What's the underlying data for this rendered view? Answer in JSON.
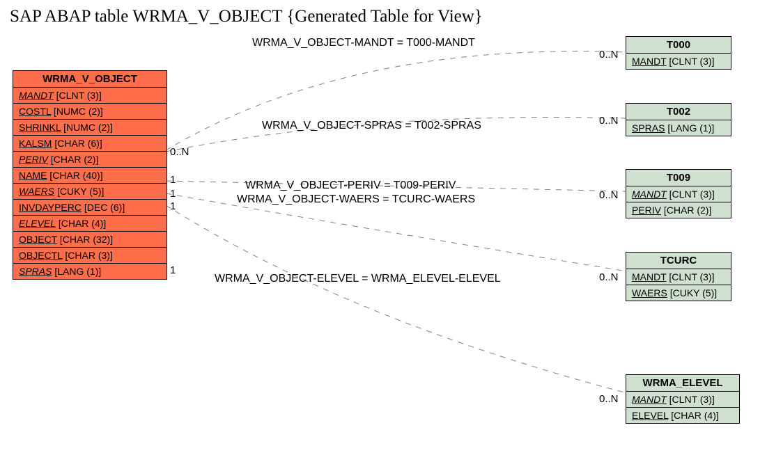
{
  "title": "SAP ABAP table WRMA_V_OBJECT {Generated Table for View}",
  "mainEntity": {
    "name": "WRMA_V_OBJECT",
    "fields": [
      {
        "name": "MANDT",
        "type": "[CLNT (3)]",
        "italic": true,
        "underline": true
      },
      {
        "name": "COSTL",
        "type": "[NUMC (2)]",
        "italic": false,
        "underline": true
      },
      {
        "name": "SHRINKL",
        "type": "[NUMC (2)]",
        "italic": false,
        "underline": true
      },
      {
        "name": "KALSM",
        "type": "[CHAR (6)]",
        "italic": false,
        "underline": true
      },
      {
        "name": "PERIV",
        "type": "[CHAR (2)]",
        "italic": true,
        "underline": true
      },
      {
        "name": "NAME",
        "type": "[CHAR (40)]",
        "italic": false,
        "underline": true
      },
      {
        "name": "WAERS",
        "type": "[CUKY (5)]",
        "italic": true,
        "underline": true
      },
      {
        "name": "INVDAYPERC",
        "type": "[DEC (6)]",
        "italic": false,
        "underline": true
      },
      {
        "name": "ELEVEL",
        "type": "[CHAR (4)]",
        "italic": true,
        "underline": true
      },
      {
        "name": "OBJECT",
        "type": "[CHAR (32)]",
        "italic": false,
        "underline": true
      },
      {
        "name": "OBJECTL",
        "type": "[CHAR (3)]",
        "italic": false,
        "underline": true
      },
      {
        "name": "SPRAS",
        "type": "[LANG (1)]",
        "italic": true,
        "underline": true
      }
    ]
  },
  "rightEntities": [
    {
      "name": "T000",
      "fields": [
        {
          "name": "MANDT",
          "type": "[CLNT (3)]",
          "italic": false,
          "underline": true
        }
      ]
    },
    {
      "name": "T002",
      "fields": [
        {
          "name": "SPRAS",
          "type": "[LANG (1)]",
          "italic": false,
          "underline": true
        }
      ]
    },
    {
      "name": "T009",
      "fields": [
        {
          "name": "MANDT",
          "type": "[CLNT (3)]",
          "italic": true,
          "underline": true
        },
        {
          "name": "PERIV",
          "type": "[CHAR (2)]",
          "italic": false,
          "underline": true
        }
      ]
    },
    {
      "name": "TCURC",
      "fields": [
        {
          "name": "MANDT",
          "type": "[CLNT (3)]",
          "italic": false,
          "underline": true
        },
        {
          "name": "WAERS",
          "type": "[CUKY (5)]",
          "italic": false,
          "underline": true
        }
      ]
    },
    {
      "name": "WRMA_ELEVEL",
      "fields": [
        {
          "name": "MANDT",
          "type": "[CLNT (3)]",
          "italic": true,
          "underline": true
        },
        {
          "name": "ELEVEL",
          "type": "[CHAR (4)]",
          "italic": false,
          "underline": true
        }
      ]
    }
  ],
  "relations": {
    "r1": "WRMA_V_OBJECT-MANDT = T000-MANDT",
    "r2": "WRMA_V_OBJECT-SPRAS = T002-SPRAS",
    "r3a": "WRMA_V_OBJECT-PERIV = T009-PERIV",
    "r3b": "WRMA_V_OBJECT-WAERS = TCURC-WAERS",
    "r5": "WRMA_V_OBJECT-ELEVEL = WRMA_ELEVEL-ELEVEL"
  },
  "card": {
    "left1": "0..N",
    "leftA": "1",
    "leftB": "1",
    "leftC": "1",
    "leftD": "1",
    "r1": "0..N",
    "r2": "0..N",
    "r3": "0..N",
    "r4": "0..N",
    "r5": "0..N"
  }
}
